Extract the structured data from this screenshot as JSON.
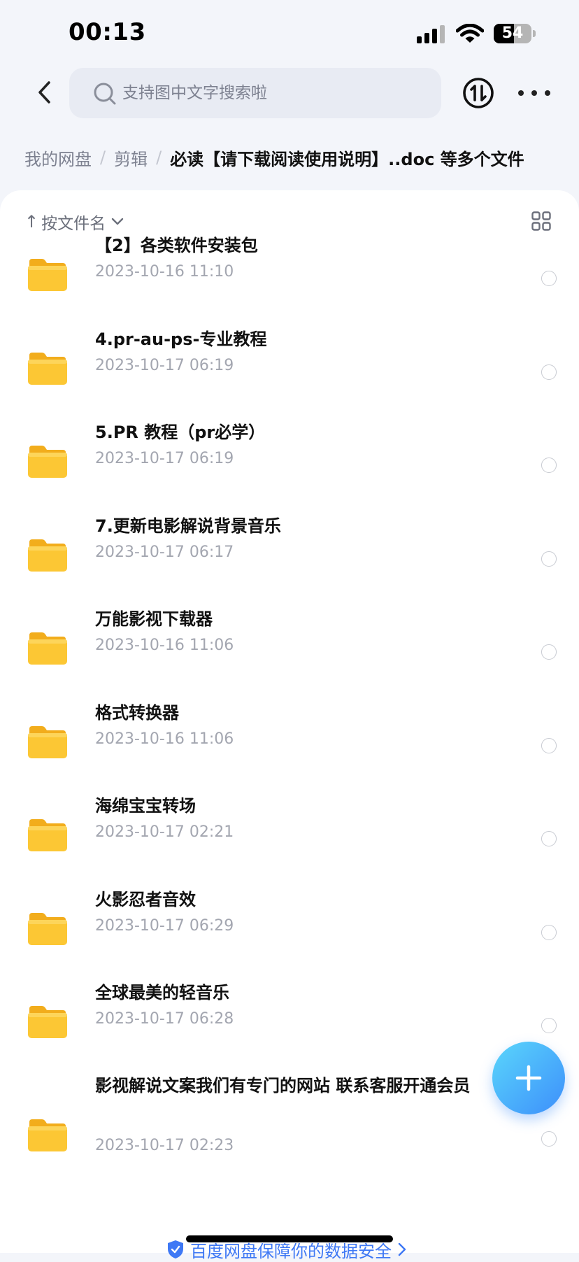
{
  "status_bar": {
    "time": "00:13",
    "battery_level": 54,
    "battery_text": "54",
    "icons": [
      "signal-icon",
      "wifi-icon",
      "battery-icon"
    ]
  },
  "header": {
    "back_icon": "chevron-left-icon",
    "search_icon": "search-icon",
    "search_placeholder": "支持图中文字搜索啦",
    "search_value": "",
    "transfer_icon": "transfer-icon",
    "more_icon": "more-icon"
  },
  "breadcrumb": {
    "items": [
      "我的网盘",
      "剪辑"
    ],
    "separator": "/",
    "current": "必读【请下载阅读使用说明】..doc 等多个文件"
  },
  "sort": {
    "label": "按文件名",
    "arrow": "↑",
    "chevron_icon": "chevron-down-icon",
    "view_toggle_icon": "grid-view-icon"
  },
  "files": [
    {
      "name": "【2】各类软件安装包",
      "date": "2023-10-16 11:10"
    },
    {
      "name": "4.pr-au-ps-专业教程",
      "date": "2023-10-17 06:19"
    },
    {
      "name": "5.PR 教程（pr必学）",
      "date": "2023-10-17 06:19"
    },
    {
      "name": "7.更新电影解说背景音乐",
      "date": "2023-10-17 06:17"
    },
    {
      "name": "万能影视下载器",
      "date": "2023-10-16 11:06"
    },
    {
      "name": "格式转换器",
      "date": "2023-10-16 11:06"
    },
    {
      "name": "海绵宝宝转场",
      "date": "2023-10-17 02:21"
    },
    {
      "name": "火影忍者音效",
      "date": "2023-10-17 06:29"
    },
    {
      "name": "全球最美的轻音乐",
      "date": "2023-10-17 06:28"
    },
    {
      "name": "影视解说文案我们有专门的网站 联系客服开通会员",
      "date": "2023-10-17 02:23"
    }
  ],
  "fab": {
    "icon": "plus-icon"
  },
  "footer": {
    "security_text": "百度网盘保障你的数据安全",
    "shield_icon": "shield-icon",
    "chevron_icon": "chevron-right-icon"
  },
  "colors": {
    "accent": "#3e78f5",
    "folder": "#fbc52e",
    "background": "#f3f5fa"
  }
}
